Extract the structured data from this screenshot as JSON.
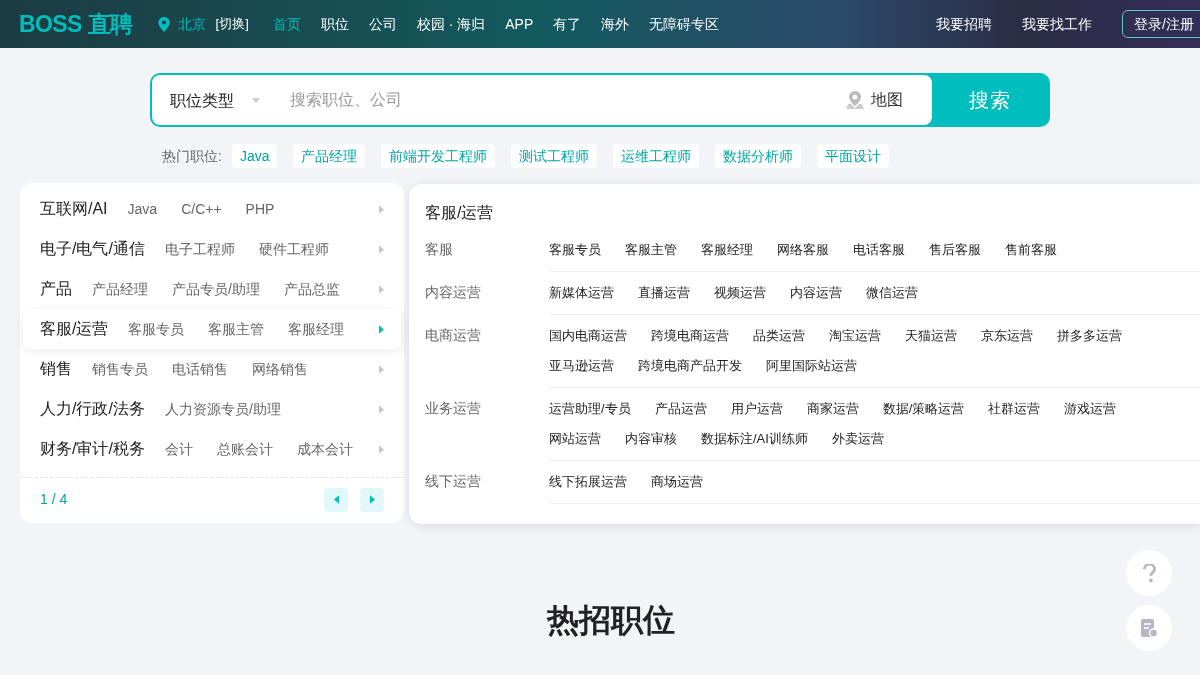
{
  "header": {
    "logo": "BOSS 直聘",
    "city": "北京",
    "switch_city": "[切换]",
    "nav": [
      {
        "label": "首页",
        "selected": true
      },
      {
        "label": "职位",
        "selected": false
      },
      {
        "label": "公司",
        "selected": false
      },
      {
        "label": "校园 · 海归",
        "selected": false
      },
      {
        "label": "APP",
        "selected": false
      },
      {
        "label": "有了",
        "selected": false
      },
      {
        "label": "海外",
        "selected": false
      },
      {
        "label": "无障碍专区",
        "selected": false
      }
    ],
    "links": [
      "我要招聘",
      "我要找工作"
    ],
    "login": "登录/注册"
  },
  "search": {
    "category": "职位类型",
    "placeholder": "搜索职位、公司",
    "map": "地图",
    "button": "搜索"
  },
  "hot_label": "热门职位:",
  "hot_tags": [
    "Java",
    "产品经理",
    "前端开发工程师",
    "测试工程师",
    "运维工程师",
    "数据分析师",
    "平面设计"
  ],
  "categories": [
    {
      "name": "互联网/AI",
      "jobs": [
        "Java",
        "C/C++",
        "PHP"
      ],
      "selected": false
    },
    {
      "name": "电子/电气/通信",
      "jobs": [
        "电子工程师",
        "硬件工程师"
      ],
      "selected": false
    },
    {
      "name": "产品",
      "jobs": [
        "产品经理",
        "产品专员/助理",
        "产品总监"
      ],
      "selected": false
    },
    {
      "name": "客服/运营",
      "jobs": [
        "客服专员",
        "客服主管",
        "客服经理"
      ],
      "selected": true
    },
    {
      "name": "销售",
      "jobs": [
        "销售专员",
        "电话销售",
        "网络销售"
      ],
      "selected": false
    },
    {
      "name": "人力/行政/法务",
      "jobs": [
        "人力资源专员/助理"
      ],
      "selected": false
    },
    {
      "name": "财务/审计/税务",
      "jobs": [
        "会计",
        "总账会计",
        "成本会计"
      ],
      "selected": false
    }
  ],
  "pager": "1 / 4",
  "detail": {
    "title": "客服/运营",
    "groups": [
      {
        "name": "客服",
        "jobs": [
          "客服专员",
          "客服主管",
          "客服经理",
          "网络客服",
          "电话客服",
          "售后客服",
          "售前客服"
        ]
      },
      {
        "name": "内容运营",
        "jobs": [
          "新媒体运营",
          "直播运营",
          "视频运营",
          "内容运营",
          "微信运营"
        ]
      },
      {
        "name": "电商运营",
        "jobs": [
          "国内电商运营",
          "跨境电商运营",
          "品类运营",
          "淘宝运营",
          "天猫运营",
          "京东运营",
          "拼多多运营",
          "亚马逊运营",
          "跨境电商产品开发",
          "阿里国际站运营"
        ]
      },
      {
        "name": "业务运营",
        "jobs": [
          "运营助理/专员",
          "产品运营",
          "用户运营",
          "商家运营",
          "数据/策略运营",
          "社群运营",
          "游戏运营",
          "网站运营",
          "内容审核",
          "数据标注/AI训练师",
          "外卖运营"
        ]
      },
      {
        "name": "线下运营",
        "jobs": [
          "线下拓展运营",
          "商场运营"
        ]
      }
    ]
  },
  "hot_title": "热招职位"
}
